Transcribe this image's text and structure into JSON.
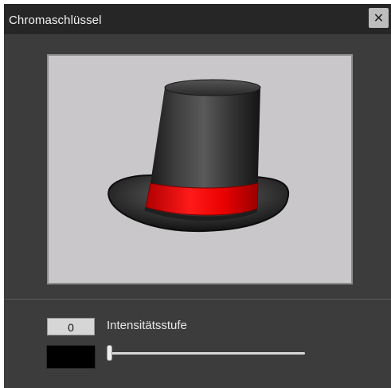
{
  "window": {
    "title": "Chromaschlüssel",
    "close_icon": "close-icon"
  },
  "preview": {
    "image_subject": "top-hat",
    "background_color": "#c9c7ca"
  },
  "controls": {
    "intensity_value": "0",
    "intensity_label": "Intensitätsstufe",
    "key_color": "#000000",
    "slider_level": 0
  }
}
